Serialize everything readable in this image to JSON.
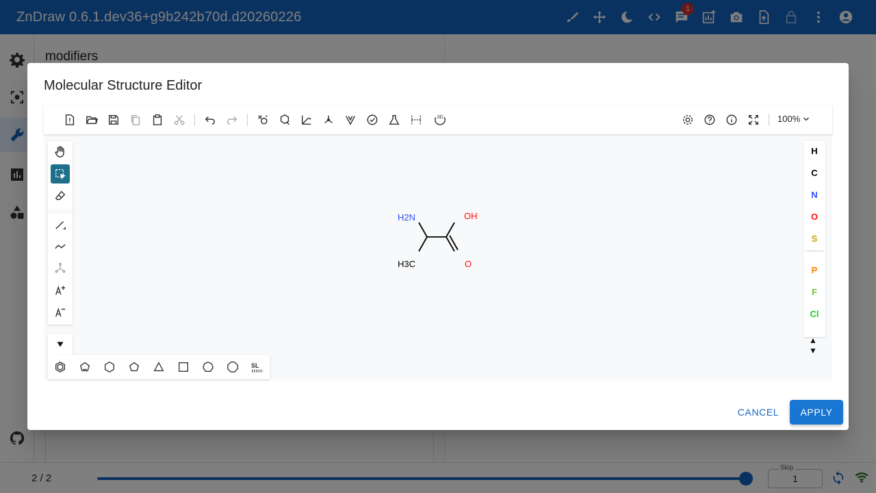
{
  "app": {
    "title": "ZnDraw 0.6.1.dev36+g9b242b70d.d20260226",
    "notification_count": "1",
    "actions": [
      "brush-icon",
      "move-icon",
      "dark-mode-icon",
      "code-icon",
      "chat-icon",
      "chart-add-icon",
      "camera-icon",
      "upload-icon",
      "lock-icon",
      "more-vert-icon",
      "account-icon"
    ]
  },
  "sidebar": {
    "items": [
      "settings-icon",
      "selection-icon",
      "wrench-icon",
      "analysis-icon",
      "geometry-icon",
      "github-icon"
    ],
    "active": "wrench-icon"
  },
  "panel": {
    "title": "modifiers"
  },
  "bottom": {
    "frame": "2 / 2",
    "skip_label": "Skip",
    "skip_value": "1",
    "progress": 1.0
  },
  "dialog": {
    "title": "Molecular Structure Editor",
    "cancel_label": "CANCEL",
    "apply_label": "APPLY"
  },
  "editor": {
    "zoom": "100%",
    "elements": [
      {
        "symbol": "H",
        "color": "#000000"
      },
      {
        "symbol": "C",
        "color": "#000000"
      },
      {
        "symbol": "N",
        "color": "#304ff7"
      },
      {
        "symbol": "O",
        "color": "#ff0d0d"
      },
      {
        "symbol": "S",
        "color": "#c9a700"
      }
    ],
    "elements2": [
      {
        "symbol": "P",
        "color": "#ff8000"
      },
      {
        "symbol": "F",
        "color": "#78c03c"
      },
      {
        "symbol": "Cl",
        "color": "#1fd01f"
      }
    ],
    "molecule_labels": {
      "amine": "H2N",
      "hydroxyl": "OH",
      "methyl": "H3C",
      "carbonyl": "O"
    },
    "ring_sl_label": "SL"
  }
}
